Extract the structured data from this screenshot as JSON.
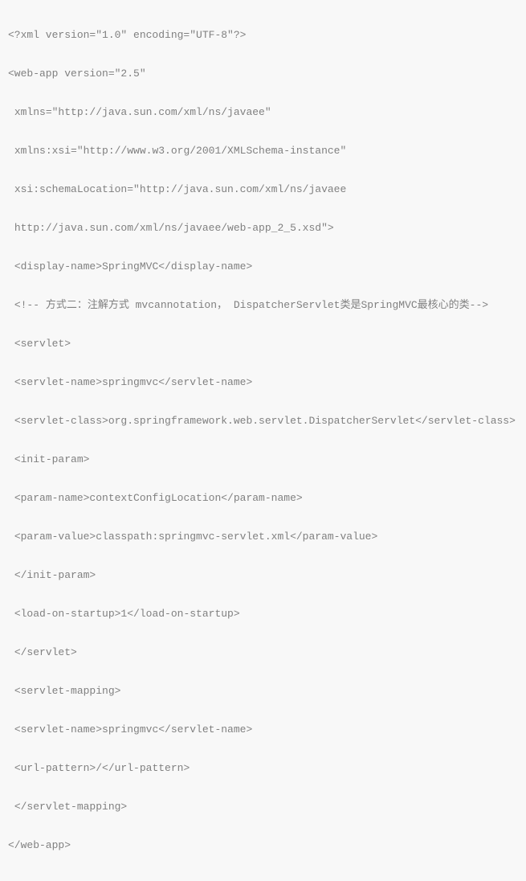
{
  "code": {
    "lines": [
      "<?xml version=\"1.0\" encoding=\"UTF-8\"?>",
      "<web-app version=\"2.5\"",
      " xmlns=\"http://java.sun.com/xml/ns/javaee\"",
      " xmlns:xsi=\"http://www.w3.org/2001/XMLSchema-instance\"",
      " xsi:schemaLocation=\"http://java.sun.com/xml/ns/javaee",
      " http://java.sun.com/xml/ns/javaee/web-app_2_5.xsd\">",
      " <display-name>SpringMVC</display-name>",
      " <!-- 方式二：注解方式 mvcannotation， DispatcherServlet类是SpringMVC最核心的类-->",
      " <servlet>",
      " <servlet-name>springmvc</servlet-name>",
      " <servlet-class>org.springframework.web.servlet.DispatcherServlet</servlet-class>",
      " <init-param>",
      " <param-name>contextConfigLocation</param-name>",
      " <param-value>classpath:springmvc-servlet.xml</param-value>",
      " </init-param>",
      " <load-on-startup>1</load-on-startup>",
      " </servlet>",
      " <servlet-mapping>",
      " <servlet-name>springmvc</servlet-name>",
      " <url-pattern>/</url-pattern>",
      " </servlet-mapping>",
      "</web-app>"
    ]
  }
}
